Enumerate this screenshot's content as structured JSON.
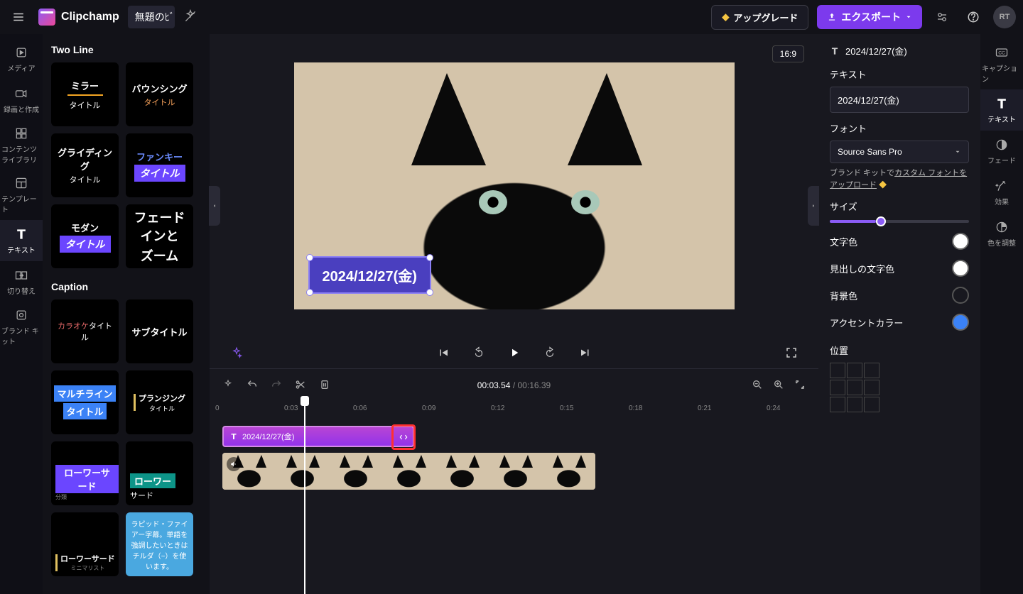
{
  "app": {
    "name": "Clipchamp",
    "project": "無題のﾋﾞ",
    "avatar": "RT"
  },
  "topbar": {
    "upgrade": "アップグレード",
    "export": "エクスポート"
  },
  "nav": [
    {
      "icon": "media",
      "label": "メディア"
    },
    {
      "icon": "record",
      "label": "録画と作成"
    },
    {
      "icon": "library",
      "label": "コンテンツライブラリ"
    },
    {
      "icon": "template",
      "label": "テンプレート"
    },
    {
      "icon": "text",
      "label": "テキスト",
      "active": true
    },
    {
      "icon": "transition",
      "label": "切り替え"
    },
    {
      "icon": "brand",
      "label": "ブランド キット"
    }
  ],
  "textPanel": {
    "sec1": "Two Line",
    "presets1": [
      {
        "l1": "ミラー",
        "l2": "タイトル",
        "accentBar": true
      },
      {
        "l1": "バウンシング",
        "l2": "タイトル",
        "l2c": "#f5a05a"
      },
      {
        "l1": "グライディング",
        "l2": "タイトル"
      },
      {
        "l1": "ファンキー",
        "l2": "タイトル",
        "l1c": "#6b8cff",
        "l2bg": "#6b46ff"
      },
      {
        "l1": "モダン",
        "l2": "タイトル",
        "l2bg": "#6b46ff"
      },
      {
        "l1": "フェードインと",
        "l2": "ズーム",
        "big": true
      }
    ],
    "sec2": "Caption",
    "presets2": [
      {
        "l1": "カラオケ",
        "l2": "タイトル",
        "l1c": "#e86a6a",
        "inline": true
      },
      {
        "l1": "サブタイトル"
      },
      {
        "l1": "マルチライン",
        "l2": "タイトル",
        "bg": "#3b82f6",
        "stack": true
      },
      {
        "l1": "プランジング",
        "l2": "タイトル",
        "bar": true
      },
      {
        "l1": "ローワーサード",
        "sub": "分類",
        "bg": "#6b46ff",
        "bottom": true
      },
      {
        "l1": "ローワー",
        "l2": "サード",
        "bg": "#0d9488",
        "bottom": true
      },
      {
        "l1": "ローワーサード",
        "sub": "ミニマリスト",
        "bottom": true,
        "bar": true
      },
      {
        "text": "ラピッド・ファイアー字幕。単語を強調したいときはチルダ（~）を使います。",
        "bg": "#4aa8e0",
        "full": true
      }
    ]
  },
  "preview": {
    "aspect": "16:9",
    "textOverlay": "2024/12/27(金)"
  },
  "player": {
    "current": "00:03.54",
    "total": "00:16.39"
  },
  "ruler": [
    "0",
    "0:03",
    "0:06",
    "0:09",
    "0:12",
    "0:15",
    "0:18",
    "0:21",
    "0:24"
  ],
  "timeline": {
    "textClip": "2024/12/27(金)"
  },
  "props": {
    "header": "2024/12/27(金)",
    "textLabel": "テキスト",
    "textValue": "2024/12/27(金)",
    "fontLabel": "フォント",
    "fontValue": "Source Sans Pro",
    "brandHint1": "ブランド キットで",
    "brandHint2": "カスタム フォントをアップロード",
    "sizeLabel": "サイズ",
    "colors": [
      {
        "label": "文字色",
        "val": "#ffffff"
      },
      {
        "label": "見出しの文字色",
        "val": "#ffffff"
      },
      {
        "label": "背景色",
        "val": "transparent"
      },
      {
        "label": "アクセントカラー",
        "val": "#3b82f6"
      }
    ],
    "posLabel": "位置"
  },
  "propsRail": [
    {
      "icon": "cc",
      "label": "キャプション"
    },
    {
      "icon": "text",
      "label": "テキスト",
      "active": true
    },
    {
      "icon": "fade",
      "label": "フェード"
    },
    {
      "icon": "fx",
      "label": "効果"
    },
    {
      "icon": "adjust",
      "label": "色を調整"
    }
  ]
}
